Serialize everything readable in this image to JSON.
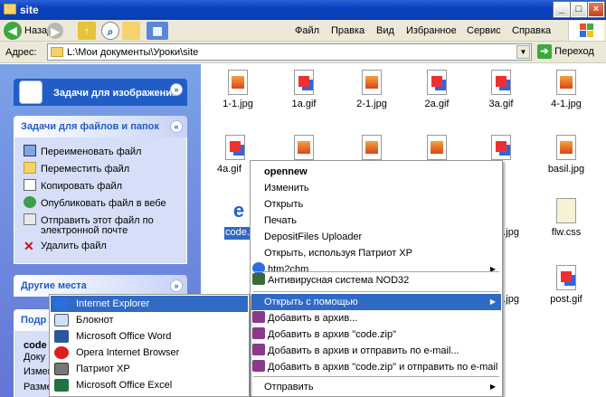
{
  "window": {
    "title": "site"
  },
  "toolbar": {
    "back": "Назад",
    "menu": [
      "Файл",
      "Правка",
      "Вид",
      "Избранное",
      "Сервис",
      "Справка"
    ]
  },
  "address": {
    "label": "Адрес:",
    "path": "L:\\Мои документы\\Уроки\\site",
    "go": "Переход"
  },
  "left": {
    "image_tasks": "Задачи для изображений",
    "file_tasks": "Задачи для файлов и папок",
    "tasks": [
      "Переименовать файл",
      "Переместить файл",
      "Копировать файл",
      "Опубликовать файл в вебе",
      "Отправить этот файл по",
      "электронной почте",
      "Удалить файл"
    ],
    "other_places": "Другие места",
    "details": "Подр",
    "details_name": "code",
    "details_l1": "Доку",
    "details_l2": "Измен",
    "details_l3": "Разме"
  },
  "files": [
    {
      "name": "1-1.jpg",
      "type": "jpg"
    },
    {
      "name": "1a.gif",
      "type": "gif"
    },
    {
      "name": "2-1.jpg",
      "type": "jpg"
    },
    {
      "name": "2a.gif",
      "type": "gif"
    },
    {
      "name": "3a.gif",
      "type": "gif"
    },
    {
      "name": "4-1.jpg",
      "type": "jpg"
    },
    {
      "name": "4a.gif",
      "type": "gif"
    },
    {
      "name": "basil.jpg",
      "type": "jpg"
    },
    {
      "name": "code.htm",
      "type": "ie"
    },
    {
      "name": "flw.css",
      "type": "css"
    },
    {
      "name": "post.gif",
      "type": "gif"
    }
  ],
  "context_menu": {
    "items": [
      "opennew",
      "Изменить",
      "Открыть",
      "Печать",
      "DepositFiles Uploader",
      "Открыть, используя Патриот XP",
      "htm2chm",
      "Антивирусная система NOD32",
      "Открыть с помощью",
      "Добавить в архив...",
      "Добавить в архив \"code.zip\"",
      "Добавить в архив и отправить по e-mail...",
      "Добавить в архив \"code.zip\" и отправить по e-mail",
      "Отправить"
    ]
  },
  "open_with": {
    "items": [
      "Internet Explorer",
      "Блокнот",
      "Microsoft Office Word",
      "Opera Internet Browser",
      "Патриот XP",
      "Microsoft Office Excel"
    ]
  },
  "colors": {
    "accent": "#316ac5",
    "titlebar": "#0a3fc0",
    "panel": "#d6dff7"
  }
}
